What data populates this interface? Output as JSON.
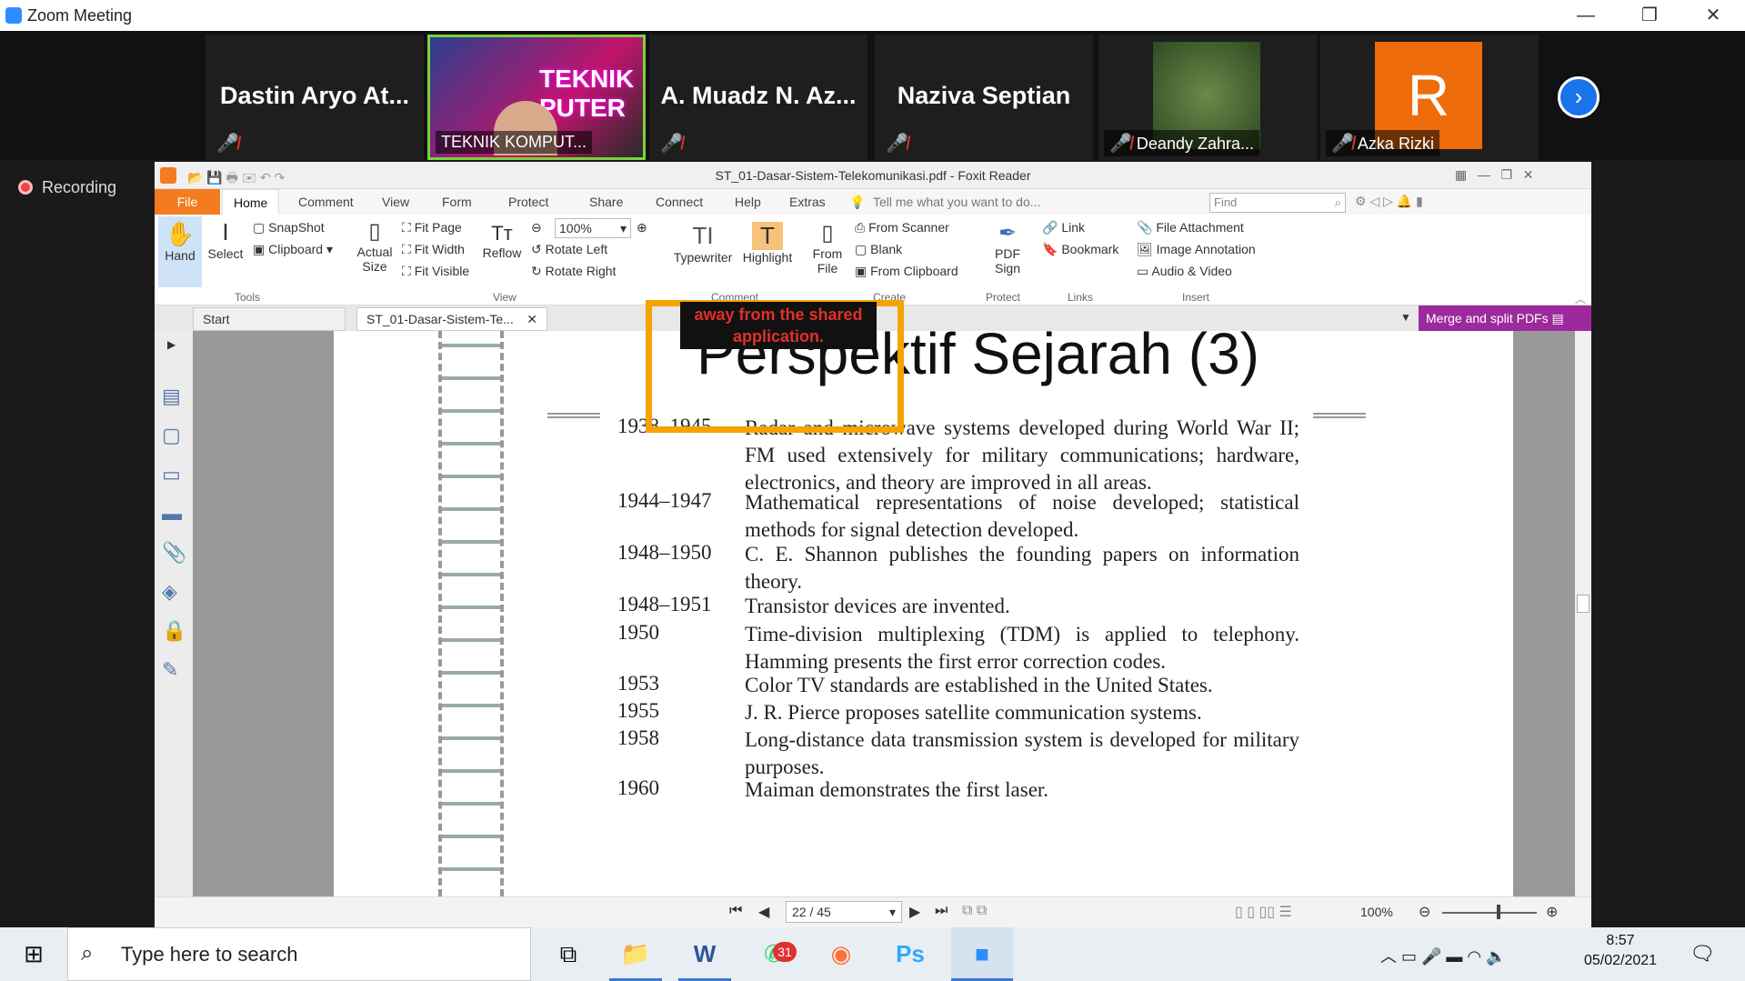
{
  "window": {
    "title": "Zoom Meeting",
    "min": "—",
    "max": "❐",
    "close": "✕"
  },
  "participants": [
    {
      "name": "Dastin Aryo At...",
      "muted": true
    },
    {
      "name": "TEKNIK KOMPUT...",
      "video": true,
      "overlay": "TEKNIK PUTER"
    },
    {
      "name": "A. Muadz N. Az...",
      "muted": true
    },
    {
      "name": "Naziva Septian",
      "muted": true
    },
    {
      "name": "Deandy Zahra...",
      "video": true
    },
    {
      "name": "Azka Rizki",
      "avatar": "R",
      "avatar_color": "#ef6c0a"
    }
  ],
  "next_icon": "chevron-right-icon",
  "recording": "Recording",
  "foxit": {
    "title": "ST_01-Dasar-Sistem-Telekomunikasi.pdf - Foxit Reader",
    "tabs": [
      "File",
      "Home",
      "Comment",
      "View",
      "Form",
      "Protect",
      "Share",
      "Connect",
      "Help",
      "Extras"
    ],
    "tell_me": "Tell me what you want to do...",
    "find_placeholder": "Find",
    "tools": {
      "hand": "Hand",
      "select": "Select",
      "snapshot": "SnapShot",
      "clipboard": "Clipboard",
      "group": "Tools"
    },
    "view": {
      "actual": "Actual",
      "size": "Size",
      "fit_page": "Fit Page",
      "fit_width": "Fit Width",
      "fit_visible": "Fit Visible",
      "reflow": "Reflow",
      "zoom": "100%",
      "rotate_left": "Rotate Left",
      "rotate_right": "Rotate Right",
      "group": "View"
    },
    "comment": {
      "typewriter": "Typewriter",
      "highlight": "Highlight",
      "group": "Comment"
    },
    "create": {
      "from": "From",
      "file": "File",
      "scanner": "From Scanner",
      "blank": "Blank",
      "clipboard": "From Clipboard",
      "group": "Create"
    },
    "protect": {
      "pdf": "PDF",
      "sign": "Sign",
      "group": "Protect"
    },
    "links": {
      "link": "Link",
      "bookmark": "Bookmark",
      "group": "Links"
    },
    "insert": {
      "attachment": "File Attachment",
      "image": "Image Annotation",
      "audio": "Audio & Video",
      "group": "Insert"
    },
    "doc_tabs": [
      "Start",
      "ST_01-Dasar-Sistem-Te..."
    ],
    "merge": "Merge and split PDFs",
    "page_nav": "22 / 45",
    "zoom_status": "100%"
  },
  "share_notice": "away from the shared application.",
  "slide": {
    "title": "Perspektif Sejarah (3)",
    "entries": [
      {
        "year": "1938–1945",
        "text": "Radar and microwave systems developed during World War II; FM used extensively for military communications; hardware, electronics, and theory are improved in all areas."
      },
      {
        "year": "1944–1947",
        "text": "Mathematical representations of noise developed; statistical methods for signal detection developed."
      },
      {
        "year": "1948–1950",
        "text": "C. E. Shannon publishes the founding papers on information theory."
      },
      {
        "year": "1948–1951",
        "text": "Transistor devices are invented."
      },
      {
        "year": "1950",
        "text": "Time-division multiplexing (TDM) is applied to telephony. Hamming presents the first error correction codes."
      },
      {
        "year": "1953",
        "text": "Color TV standards are established in the United States."
      },
      {
        "year": "1955",
        "text": "J. R. Pierce proposes satellite communication systems."
      },
      {
        "year": "1958",
        "text": "Long-distance data transmission system is developed for military purposes."
      },
      {
        "year": "1960",
        "text": "Maiman demonstrates the first laser."
      }
    ]
  },
  "taskbar": {
    "search": "Type here to search",
    "badge": "31",
    "time": "8:57",
    "date": "05/02/2021"
  }
}
